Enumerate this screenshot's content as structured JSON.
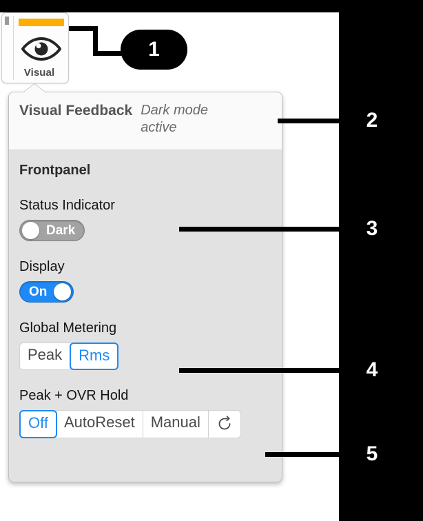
{
  "toolbar": {
    "visual_button": {
      "label": "Visual",
      "icon": "eye-icon",
      "accent_color": "#fdad00"
    }
  },
  "panel": {
    "title": "Visual Feedback",
    "subtitle": "Dark mode active",
    "section_title": "Frontpanel",
    "fields": [
      {
        "label": "Status Indicator",
        "type": "toggle",
        "state": "off",
        "value_text": "Dark"
      },
      {
        "label": "Display",
        "type": "toggle",
        "state": "on",
        "value_text": "On"
      },
      {
        "label": "Global Metering",
        "type": "segmented",
        "options": [
          "Peak",
          "Rms"
        ],
        "selected": "Rms"
      },
      {
        "label": "Peak + OVR Hold",
        "type": "segmented",
        "options": [
          "Off",
          "AutoReset",
          "Manual",
          "reset-icon"
        ],
        "selected": "Off",
        "reset_icon_label": "↺"
      }
    ]
  },
  "callouts": [
    {
      "number": "1",
      "target": "visual-button"
    },
    {
      "number": "2",
      "target": "panel-header"
    },
    {
      "number": "3",
      "target": "status-indicator-toggle"
    },
    {
      "number": "4",
      "target": "global-metering-segmented"
    },
    {
      "number": "5",
      "target": "peak-ovr-hold-segmented"
    }
  ],
  "colors": {
    "accent_orange": "#fdad00",
    "accent_blue": "#1f8af5",
    "panel_bg": "#e2e2e2",
    "header_bg": "#fafafa",
    "frame_black": "#000000"
  }
}
